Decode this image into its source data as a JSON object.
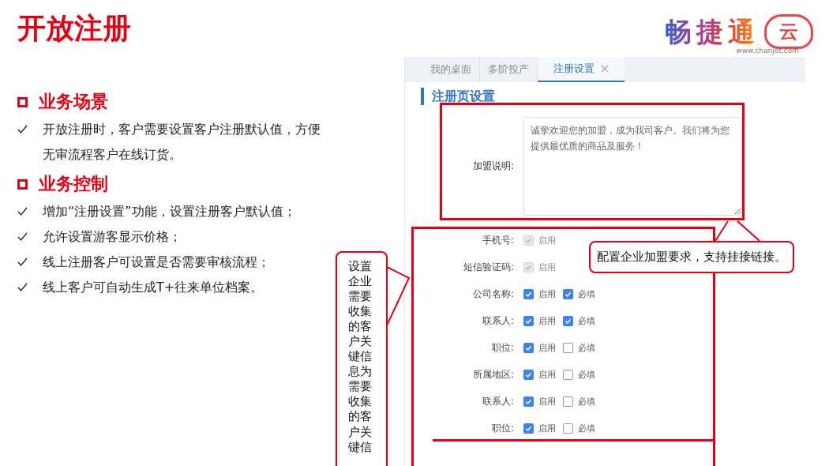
{
  "slide_title": "开放注册",
  "logo": {
    "name": "畅捷通",
    "badge": "云",
    "url": "www.chanjet.com"
  },
  "sections": [
    {
      "heading": "业务场景",
      "bullets": [
        "开放注册时，客户需要设置客户注册默认值，方便无审流程客户在线订货。"
      ]
    },
    {
      "heading": "业务控制",
      "bullets": [
        "增加“注册设置”功能，设置注册客户默认值；",
        "允许设置游客显示价格；",
        "线上注册客户可设置是否需要审核流程；",
        "线上客户可自动生成T+往来单位档案。"
      ]
    }
  ],
  "app": {
    "tabs": [
      {
        "label": "我的桌面",
        "selected": false,
        "closable": false
      },
      {
        "label": "多阶投产",
        "selected": false,
        "closable": false
      },
      {
        "label": "注册设置",
        "selected": true,
        "closable": true
      }
    ],
    "heading": "注册页设置",
    "intro": {
      "label": "加盟说明:",
      "value": "诚挚欢迎您的加盟，成为我司客户。我们将为您提供最优质的商品及服务！"
    },
    "rows": [
      {
        "label": "手机号:",
        "enable": {
          "label": "启用",
          "checked": true,
          "disabled": true
        }
      },
      {
        "label": "短信验证码:",
        "enable": {
          "label": "启用",
          "checked": true,
          "disabled": true
        }
      },
      {
        "label": "公司名称:",
        "enable": {
          "label": "启用",
          "checked": true,
          "disabled": false
        },
        "required": {
          "label": "必填",
          "checked": true
        }
      },
      {
        "label": "联系人:",
        "enable": {
          "label": "启用",
          "checked": true,
          "disabled": false
        },
        "required": {
          "label": "必填",
          "checked": true
        }
      },
      {
        "label": "职位:",
        "enable": {
          "label": "启用",
          "checked": true,
          "disabled": false
        },
        "required": {
          "label": "必填",
          "checked": false
        }
      },
      {
        "label": "所属地区:",
        "enable": {
          "label": "启用",
          "checked": true,
          "disabled": false
        },
        "required": {
          "label": "必填",
          "checked": false
        }
      },
      {
        "label": "联系人:",
        "enable": {
          "label": "启用",
          "checked": true,
          "disabled": false
        },
        "required": {
          "label": "必填",
          "checked": false
        }
      },
      {
        "label": "职位:",
        "enable": {
          "label": "启用",
          "checked": true,
          "disabled": false
        },
        "required": {
          "label": "必填",
          "checked": false
        }
      }
    ]
  },
  "callouts": [
    {
      "kind": "horizontal",
      "text": "配置企业加盟要求，支持挂接链接。"
    },
    {
      "kind": "vertical",
      "text": "设置企业需要收集的客户关键信息为需要收集的客户关键信"
    }
  ]
}
